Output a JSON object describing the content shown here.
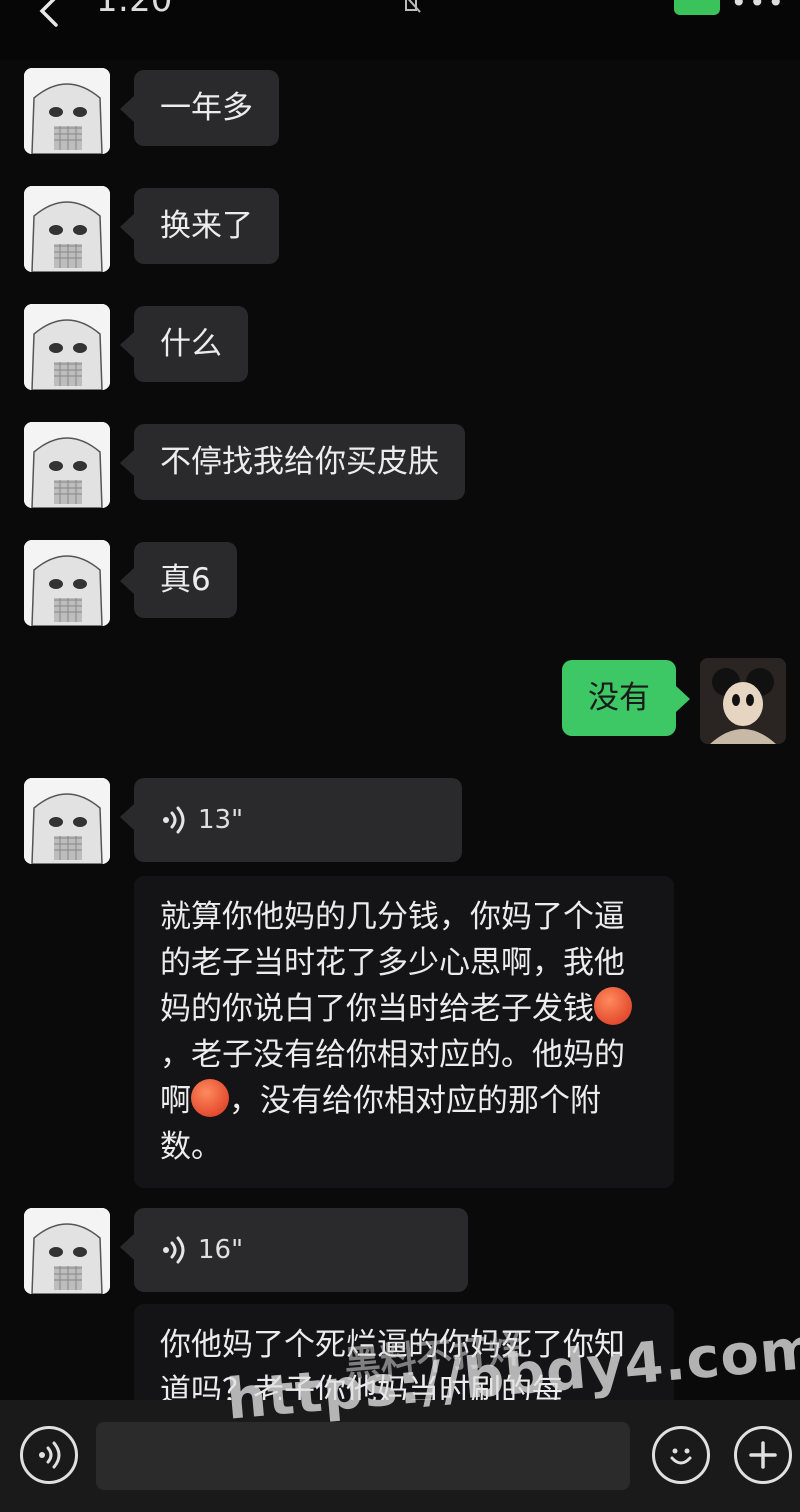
{
  "status_bar": {
    "time": "1:20"
  },
  "messages": [
    {
      "side": "in",
      "type": "text",
      "text": "一年多"
    },
    {
      "side": "in",
      "type": "text",
      "text": "换来了"
    },
    {
      "side": "in",
      "type": "text",
      "text": "什么"
    },
    {
      "side": "in",
      "type": "text",
      "text": "不停找我给你买皮肤"
    },
    {
      "side": "in",
      "type": "text",
      "text": "真6"
    },
    {
      "side": "out",
      "type": "text",
      "text": "没有"
    },
    {
      "side": "in",
      "type": "voice",
      "duration": "13\"",
      "transcript_parts": [
        "就算你他妈的几分钱，你妈了个逼的老子当时花了多少心思啊，我他妈的你说白了你当时给老子发钱",
        "，老子没有给你相对应的。他妈的啊",
        "，没有给你相对应的那个附数。"
      ]
    },
    {
      "side": "in",
      "type": "voice",
      "duration": "16\"",
      "transcript_parts": [
        "你他妈了个死烂逼的你妈死了你知道吗？老子你他妈当时刷的每"
      ]
    }
  ],
  "input_bar": {
    "voice_icon": "voice-mode-icon",
    "emoji_icon": "emoji-icon",
    "plus_icon": "plus-icon"
  },
  "watermark": {
    "url": "https://bbdy4.com",
    "cn": "黑料不打烊"
  },
  "colors": {
    "background": "#0a0a0a",
    "incoming_bubble": "#2a2a2c",
    "outgoing_bubble": "#3dc865"
  }
}
